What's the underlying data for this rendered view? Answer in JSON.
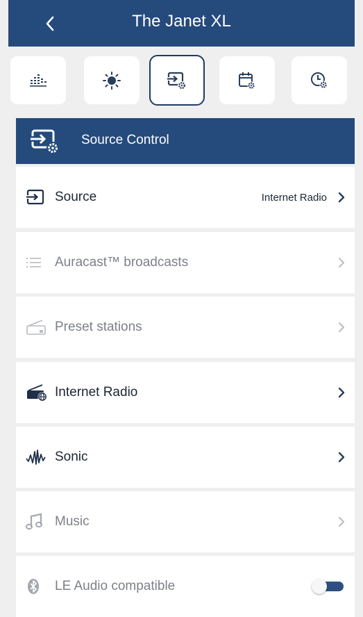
{
  "header": {
    "title": "The Janet XL",
    "back_icon": "chevron-left-icon"
  },
  "tabs": [
    {
      "icon": "equalizer-icon",
      "active": false
    },
    {
      "icon": "brightness-icon",
      "active": false
    },
    {
      "icon": "source-settings-icon",
      "active": true
    },
    {
      "icon": "calendar-settings-icon",
      "active": false
    },
    {
      "icon": "clock-settings-icon",
      "active": false
    }
  ],
  "section": {
    "title": "Source Control",
    "icon": "source-settings-icon"
  },
  "rows": [
    {
      "label": "Source",
      "value": "Internet Radio",
      "icon": "source-icon",
      "enabled": true
    },
    {
      "label": "Auracast™ broadcasts",
      "icon": "list-icon",
      "enabled": false
    },
    {
      "label": "Preset stations",
      "icon": "radio-icon",
      "enabled": false
    },
    {
      "label": "Internet Radio",
      "icon": "internet-radio-icon",
      "enabled": true
    },
    {
      "label": "Sonic",
      "icon": "waveform-icon",
      "enabled": true
    },
    {
      "label": "Music",
      "icon": "music-note-icon",
      "enabled": false
    },
    {
      "label": "LE Audio compatible",
      "icon": "bluetooth-icon",
      "enabled": false,
      "toggle_on": false
    }
  ],
  "colors": {
    "brand": "#254a7c",
    "background": "#efefef",
    "text": "#1c2633",
    "muted": "#7c8088"
  }
}
